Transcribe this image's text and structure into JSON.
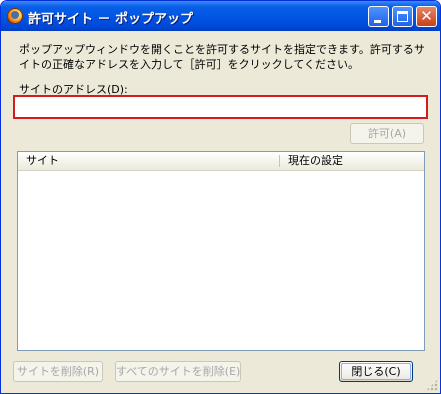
{
  "window": {
    "title": "許可サイト － ポップアップ",
    "icon": "firefox-icon"
  },
  "description": "ポップアップウィンドウを開くことを許可するサイトを指定できます。許可するサイトの正確なアドレスを入力して［許可］をクリックしてください。",
  "address": {
    "label": "サイトのアドレス(D):",
    "value": ""
  },
  "buttons": {
    "allow": "許可(A)",
    "remove_site": "サイトを削除(R)",
    "remove_all": "すべてのサイトを削除(E)",
    "close": "閉じる(C)"
  },
  "list": {
    "columns": [
      "サイト",
      "現在の設定"
    ],
    "rows": []
  },
  "colors": {
    "titlebar": "#0054e3",
    "focus_border": "#d41c1c",
    "dialog_bg": "#ece9d8"
  }
}
